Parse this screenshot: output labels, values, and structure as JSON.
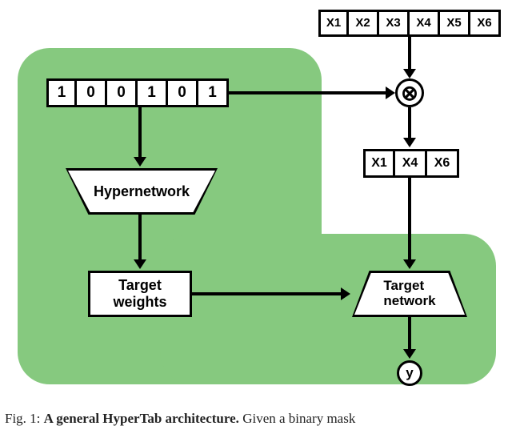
{
  "features": {
    "all": [
      "X1",
      "X2",
      "X3",
      "X4",
      "X5",
      "X6"
    ],
    "selected": [
      "X1",
      "X4",
      "X6"
    ]
  },
  "mask": [
    "1",
    "0",
    "0",
    "1",
    "0",
    "1"
  ],
  "blocks": {
    "hypernetwork": "Hypernetwork",
    "target_weights": "Target\nweights",
    "target_network": "Target\nnetwork",
    "multiply": "⊗",
    "output": "y"
  },
  "caption": {
    "prefix": "Fig. 1: ",
    "bold": "A general HyperTab architecture.",
    "rest": " Given a binary mask"
  }
}
